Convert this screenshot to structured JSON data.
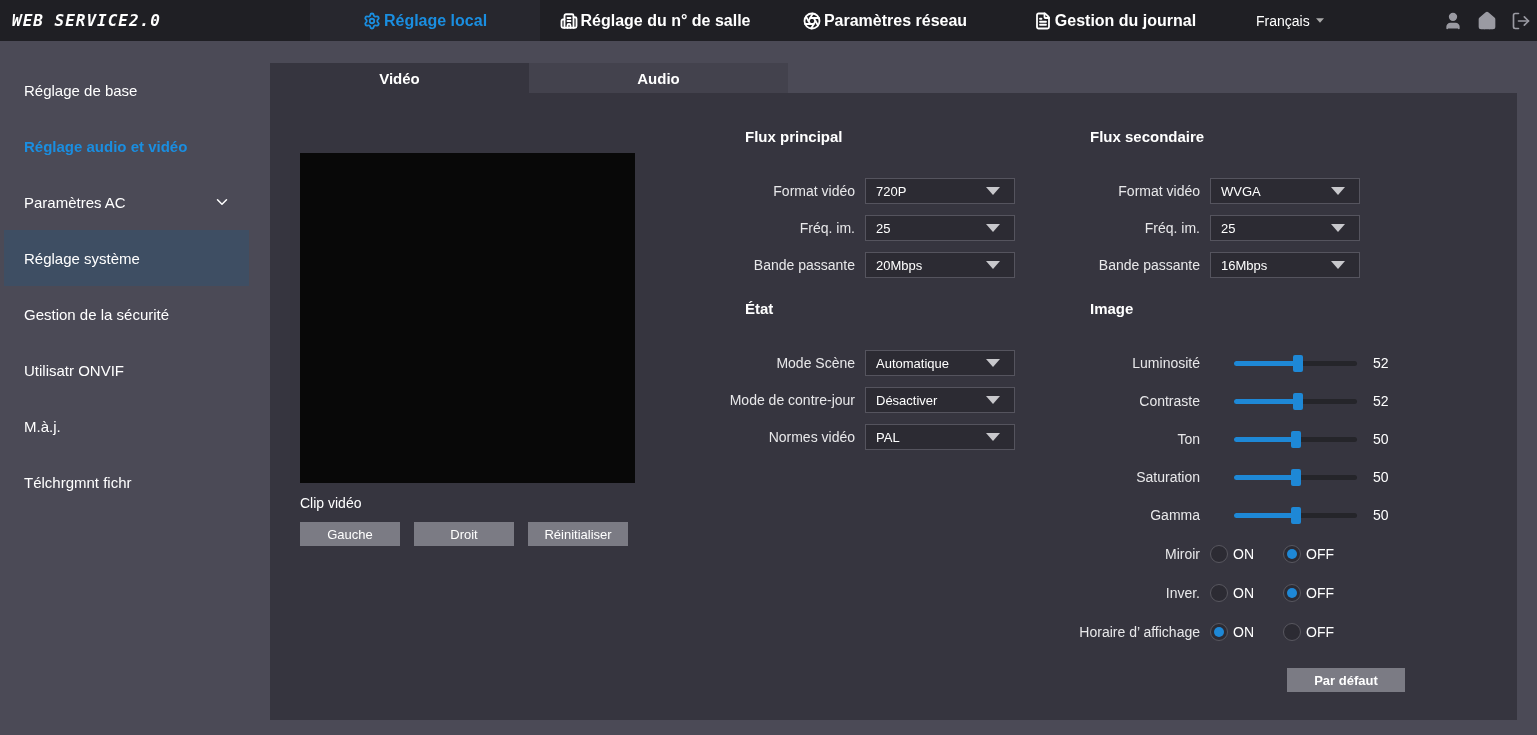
{
  "header": {
    "logo": "WEB SERVICE2.0",
    "nav": [
      {
        "label": "Réglage local",
        "selected": true
      },
      {
        "label": "Réglage du n° de salle",
        "selected": false
      },
      {
        "label": "Paramètres réseau",
        "selected": false
      },
      {
        "label": "Gestion du journal",
        "selected": false
      }
    ],
    "language": "Français"
  },
  "sidebar": {
    "items": [
      {
        "label": "Réglage de base",
        "selected": false,
        "highlighted": false,
        "has_children": false
      },
      {
        "label": "Réglage audio et vidéo",
        "selected": true,
        "highlighted": false,
        "has_children": false
      },
      {
        "label": "Paramètres AC",
        "selected": false,
        "highlighted": false,
        "has_children": true
      },
      {
        "label": "Réglage système",
        "selected": false,
        "highlighted": true,
        "has_children": false
      },
      {
        "label": "Gestion de la sécurité",
        "selected": false,
        "highlighted": false,
        "has_children": false
      },
      {
        "label": "Utilisatr ONVIF",
        "selected": false,
        "highlighted": false,
        "has_children": false
      },
      {
        "label": "M.à.j.",
        "selected": false,
        "highlighted": false,
        "has_children": false
      },
      {
        "label": "Télchrgmnt fichr",
        "selected": false,
        "highlighted": false,
        "has_children": false
      }
    ]
  },
  "tabs": [
    {
      "label": "Vidéo",
      "selected": true
    },
    {
      "label": "Audio",
      "selected": false
    }
  ],
  "preview": {
    "caption": "Clip vidéo",
    "buttons": [
      "Gauche",
      "Droit",
      "Réinitialiser"
    ]
  },
  "main_stream": {
    "title": "Flux principal",
    "fields": [
      {
        "label": "Format vidéo",
        "value": "720P"
      },
      {
        "label": "Fréq. im.",
        "value": "25"
      },
      {
        "label": "Bande passante",
        "value": "20Mbps"
      }
    ]
  },
  "state": {
    "title": "État",
    "fields": [
      {
        "label": "Mode Scène",
        "value": "Automatique"
      },
      {
        "label": "Mode de contre-jour",
        "value": "Désactiver"
      },
      {
        "label": "Normes vidéo",
        "value": "PAL"
      }
    ]
  },
  "secondary_stream": {
    "title": "Flux secondaire",
    "fields": [
      {
        "label": "Format vidéo",
        "value": "WVGA"
      },
      {
        "label": "Fréq. im.",
        "value": "25"
      },
      {
        "label": "Bande passante",
        "value": "16Mbps"
      }
    ]
  },
  "image": {
    "title": "Image",
    "sliders": [
      {
        "label": "Luminosité",
        "level": 0.52,
        "reading": "52"
      },
      {
        "label": "Contraste",
        "level": 0.52,
        "reading": "52"
      },
      {
        "label": "Ton",
        "level": 0.5,
        "reading": "50"
      },
      {
        "label": "Saturation",
        "level": 0.5,
        "reading": "50"
      },
      {
        "label": "Gamma",
        "level": 0.5,
        "reading": "50"
      }
    ],
    "toggles": [
      {
        "label": "Miroir",
        "options": [
          {
            "label": "ON",
            "selected": false
          },
          {
            "label": "OFF",
            "selected": true
          }
        ]
      },
      {
        "label": "Inver.",
        "options": [
          {
            "label": "ON",
            "selected": false
          },
          {
            "label": "OFF",
            "selected": true
          }
        ]
      },
      {
        "label": "Horaire d’  affichage",
        "options": [
          {
            "label": "ON",
            "selected": true
          },
          {
            "label": "OFF",
            "selected": false
          }
        ]
      }
    ],
    "default_button": "Par défaut"
  }
}
